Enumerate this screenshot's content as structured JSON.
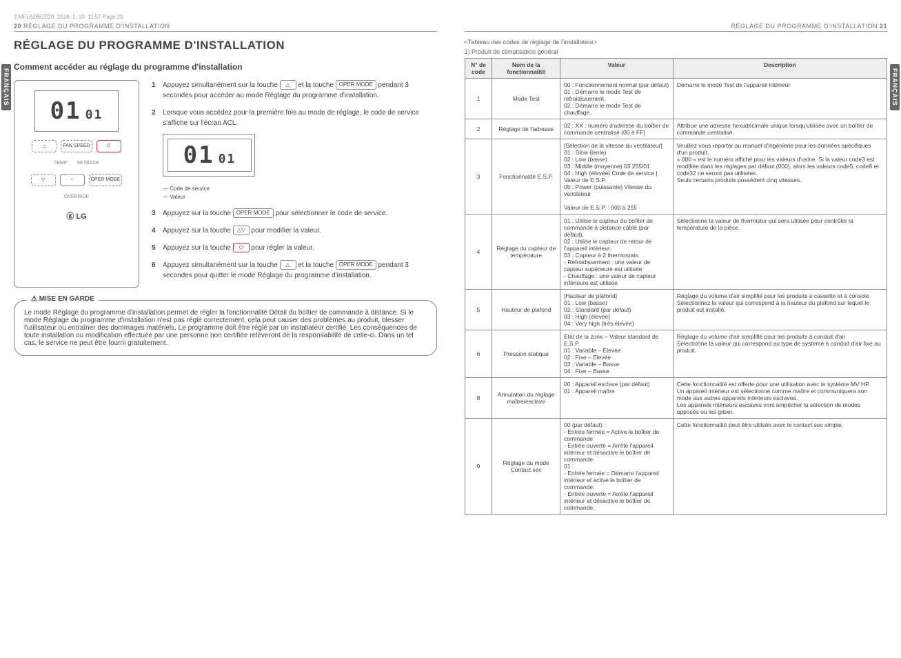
{
  "meta": {
    "topline": "2,MFL62862020,    2018. 1. 10.    11:57  Page 20"
  },
  "left": {
    "header_num": "20",
    "header_txt": "RÉGLAGE DU PROGRAMME D'INSTALLATION",
    "side_tab": "FRANÇAIS",
    "h1": "RÉGLAGE DU PROGRAMME D'INSTALLATION",
    "h2": "Comment accéder au réglage du programme d'installation",
    "remote": {
      "digits_big": "01",
      "digits_small": "01",
      "btn_up": "△",
      "btn_fan": "FAN SPEED",
      "btn_power": "⏻",
      "lbl_temp": "TEMP",
      "lbl_setback": "SETBACK",
      "btn_down": "▽",
      "btn_circle": "○",
      "btn_mode": "OPER MODE",
      "lbl_override": "OVERRIDE",
      "logo": "ⓖ LG"
    },
    "steps": {
      "s1a": "Appuyez simultanément sur la touche ",
      "s1b": " et la touche ",
      "s1c": " pendant 3 secondes pour accéder au mode Réglage du programme d'installation.",
      "s2": "Lorsque vous accédez pour la première fois au mode de réglage, le code de service s'affiche sur l'écran ACL.",
      "mini_code": "Code de service",
      "mini_val": "Valeur",
      "s3a": "Appuyez sur la touche ",
      "s3b": " pour sélectionner le code de service.",
      "s4a": "Appuyez sur la touche ",
      "s4b": " pour modifier la valeur.",
      "s5a": "Appuyez sur la touche ",
      "s5b": " pour régler la valeur.",
      "s6a": "Appuyez simultanément sur la touche ",
      "s6b": " et la touche ",
      "s6c": " pendant 3 secondes pour quitter le mode Réglage du programme d'installation."
    },
    "key_up": "△",
    "key_mode": "OPER MODE",
    "key_updn": "△▽",
    "key_power": "⏻",
    "warn_title": "MISE EN GARDE",
    "warn_body": "Le mode Réglage du programme d'installation permet de régler la fonctionnalité Détail du boîtier de commande à distance. Si le mode Réglage du programme d'installation n'est pas réglé correctement, cela peut causer des problèmes au produit, blesser l'utilisateur ou entraîner des dommages matériels. Le programme doit être réglé par un installateur certifié. Les conséquences de toute installation ou modification effectuée par une personne non certifiée relèveront de la responsabilité de celle-ci. Dans un tel cas, le service ne peut être fourni gratuitement."
  },
  "right": {
    "header_txt": "RÉGLAGE DU PROGRAMME D'INSTALLATION",
    "header_num": "21",
    "side_tab": "FRANÇAIS",
    "sub1": "<Tableau des codes de réglage de l'installateur>",
    "sub2": "1) Produit de climatisation général",
    "th1": "N° de code",
    "th2": "Nom de la fonctionnalité",
    "th3": "Valeur",
    "th4": "Description",
    "rows": [
      {
        "c": "1",
        "n": "Mode Test",
        "v": "00 : Fonctionnement normal (par défaut)\n01 : Démarre le mode Test de refroidissement.\n02 : Démarre le mode Test de chauffage.",
        "d": "Démarre le mode Test de l'appareil intérieur"
      },
      {
        "c": "2",
        "n": "Réglage de l'adresse",
        "v": "02 : XX : numéro d'adresse du boîtier de commande centralisé (00 à FF)",
        "d": "Attribue une adresse hexadécimale unique lorsqu'utilisée avec un boîtier de commande centralisé."
      },
      {
        "c": "3",
        "n": "Fonctionnalité E.S.P.",
        "v": "[Sélection de la vitesse du ventilateur]\n01 : Slow (lente)          <Exemple>\n02 : Low (basse)\n03 : Middle (moyenne)       03 255/01\n04 : High (élevée)      Code de service | Valeur de E.S.P.\n05 : Power (puissante)   Vitesse du ventilateur\n\nValeur de E.S.P. : 000 à 255",
        "d": "Veuillez vous reporter au manuel d'ingénierie pour les données spécifiques d'un produit.\n« 000 » est le numéro affiché pour les valeurs d'usine. Si la valeur code3 est modifiée dans les réglages par défaut (000), alors les valeurs code5, code6 et code32 ne seront pas utilisées.\nSeuls certains produits possèdent cinq vitesses."
      },
      {
        "c": "4",
        "n": "Réglage du capteur de température",
        "v": "01 : Utilise le capteur du boîtier de commande à distance câblé (par défaut).\n02 : Utilise le capteur de retour de l'appareil intérieur.\n03 : Capteur à 2 thermostats\n- Refroidissement : une valeur de capteur supérieure est utilisée\n- Chauffage : une valeur de capteur inférieure est utilisée",
        "d": "Sélectionne la valeur de thermistor qui sera utilisée pour contrôler la température de la pièce."
      },
      {
        "c": "5",
        "n": "Hauteur de plafond",
        "v": "[Hauteur de plafond]\n01 : Low (basse)\n02 : Standard (par défaut)\n03 : High (élevée)\n04 : Very high (très élevée)",
        "d": "Réglage du volume d'air simplifié pour les produits à cassette et à console\nSélectionnez la valeur qui correspond à la hauteur du plafond sur lequel le produit est installé."
      },
      {
        "c": "6",
        "n": "Pression statique",
        "v": "État de la zone – Valeur standard de E.S.P.\n01 : Variable – Élevée\n02 : Fixe – Élevée\n03 : Variable – Basse\n04 : Fixe – Basse",
        "d": "Réglage du volume d'air simplifié pour les produits à conduit d'air\nSélectionne la valeur qui correspond au type de système à conduit d'air fixé au produit."
      },
      {
        "c": "8",
        "n": "Annulation du réglage maître/esclave",
        "v": "00 : Appareil esclave (par défaut)\n01 : Appareil maître",
        "d": "Cette fonctionnalité est offerte pour une utilisation avec le système MV HP.\nUn appareil intérieur est sélectionné comme maître et communiquera son mode aux autres appareils intérieurs esclaves.\nLes appareils intérieurs esclaves vont empêcher la sélection de modes opposés ou les griser."
      },
      {
        "c": "9",
        "n": "Réglage du mode Contact sec",
        "v": "00 (par défaut) :\n- Entrée fermée = Active le boîtier de commande\n- Entrée ouverte = Arrête l'appareil intérieur et désactive le boîtier de commande.\n01 :\n- Entrée fermée = Démarre l'appareil intérieur et active le boîtier de commande.\n- Entrée ouverte = Arrête l'appareil intérieur et désactive le boîtier de commande.",
        "d": "Cette fonctionnalité peut être utilisée avec le contact sec simple."
      }
    ]
  }
}
